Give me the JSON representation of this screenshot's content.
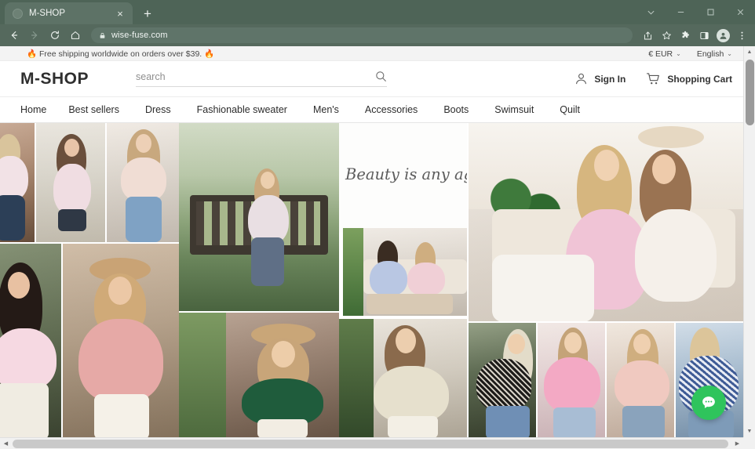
{
  "browser": {
    "tab": {
      "title": "M-SHOP",
      "favicon": "site-favicon",
      "close_label": "×"
    },
    "new_tab_label": "+",
    "window_controls": {
      "chevron": "chevron-down",
      "minimize": "minimize",
      "maximize": "maximize",
      "close": "close"
    },
    "toolbar": {
      "back": "back-arrow",
      "forward": "forward-arrow",
      "reload": "reload",
      "home": "home",
      "url": "wise-fuse.com",
      "lock": "lock-icon",
      "share": "share-icon",
      "bookmark": "star-icon",
      "extensions": "puzzle-icon",
      "sidepanel": "side-panel-icon",
      "profile": "profile-avatar",
      "menu": "three-dot-menu"
    },
    "chrome_color": "#4e6457"
  },
  "promo": {
    "text": "Free shipping worldwide on orders over $39.",
    "flame": "🔥",
    "currency": "€ EUR",
    "language": "English",
    "caret": "⌄"
  },
  "header": {
    "logo": "M-SHOP",
    "search": {
      "value": "",
      "placeholder": "search",
      "icon": "search-icon"
    },
    "sign_in": {
      "label": "Sign In",
      "icon": "person-icon"
    },
    "cart": {
      "label": "Shopping Cart",
      "icon": "cart-icon"
    }
  },
  "nav": {
    "items": [
      {
        "label": "Home"
      },
      {
        "label": "Best sellers"
      },
      {
        "label": "Dress"
      },
      {
        "label": "Fashionable sweater"
      },
      {
        "label": "Men's"
      },
      {
        "label": "Accessories"
      },
      {
        "label": "Boots"
      },
      {
        "label": "Swimsuit"
      },
      {
        "label": "Quilt"
      }
    ]
  },
  "collage": {
    "slogan": "Beauty is any age",
    "tiles": [
      {
        "name": "model-denim-porch",
        "alt": "Model in floral blouse on porch"
      },
      {
        "name": "model-pink-floral-blouse",
        "alt": "Model in pink floral blouse"
      },
      {
        "name": "model-glasses-floral",
        "alt": "Model with glasses in floral top"
      },
      {
        "name": "model-dark-hair-floral",
        "alt": "Dark haired model in floral blouse"
      },
      {
        "name": "model-hat-pink-top",
        "alt": "Model with hat in pink top"
      },
      {
        "name": "model-on-bench",
        "alt": "Model seated on garden bench"
      },
      {
        "name": "model-green-blouse-hat",
        "alt": "Model in green blouse with hat"
      },
      {
        "name": "two-women-reading",
        "alt": "Two women reading on sofa"
      },
      {
        "name": "model-floral-outdoor",
        "alt": "Model in floral top outdoors"
      },
      {
        "name": "hero-two-women-sofa",
        "alt": "Two women laughing on sofa"
      },
      {
        "name": "model-black-floral",
        "alt": "Model in black floral blouse"
      },
      {
        "name": "model-pink-floral-wall",
        "alt": "Model in pink floral blouse by wall"
      },
      {
        "name": "model-blush-floral",
        "alt": "Model in blush floral top"
      },
      {
        "name": "model-blue-floral",
        "alt": "Model in blue floral blouse"
      }
    ]
  },
  "chat": {
    "icon": "chat-bubble-icon",
    "color": "#2fc45c"
  },
  "scrollbars": {
    "vertical": {
      "up": "▲",
      "down": "▼"
    },
    "horizontal": {
      "left": "◀",
      "right": "▶"
    }
  }
}
